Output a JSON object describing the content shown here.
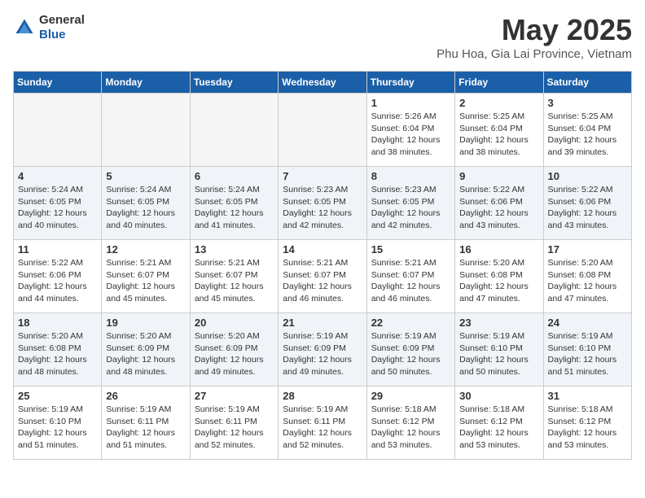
{
  "header": {
    "logo": {
      "text_general": "General",
      "text_blue": "Blue"
    },
    "title": "May 2025",
    "subtitle": "Phu Hoa, Gia Lai Province, Vietnam"
  },
  "weekdays": [
    "Sunday",
    "Monday",
    "Tuesday",
    "Wednesday",
    "Thursday",
    "Friday",
    "Saturday"
  ],
  "weeks": [
    {
      "shade": false,
      "days": [
        {
          "num": "",
          "info": ""
        },
        {
          "num": "",
          "info": ""
        },
        {
          "num": "",
          "info": ""
        },
        {
          "num": "",
          "info": ""
        },
        {
          "num": "1",
          "info": "Sunrise: 5:26 AM\nSunset: 6:04 PM\nDaylight: 12 hours\nand 38 minutes."
        },
        {
          "num": "2",
          "info": "Sunrise: 5:25 AM\nSunset: 6:04 PM\nDaylight: 12 hours\nand 38 minutes."
        },
        {
          "num": "3",
          "info": "Sunrise: 5:25 AM\nSunset: 6:04 PM\nDaylight: 12 hours\nand 39 minutes."
        }
      ]
    },
    {
      "shade": true,
      "days": [
        {
          "num": "4",
          "info": "Sunrise: 5:24 AM\nSunset: 6:05 PM\nDaylight: 12 hours\nand 40 minutes."
        },
        {
          "num": "5",
          "info": "Sunrise: 5:24 AM\nSunset: 6:05 PM\nDaylight: 12 hours\nand 40 minutes."
        },
        {
          "num": "6",
          "info": "Sunrise: 5:24 AM\nSunset: 6:05 PM\nDaylight: 12 hours\nand 41 minutes."
        },
        {
          "num": "7",
          "info": "Sunrise: 5:23 AM\nSunset: 6:05 PM\nDaylight: 12 hours\nand 42 minutes."
        },
        {
          "num": "8",
          "info": "Sunrise: 5:23 AM\nSunset: 6:05 PM\nDaylight: 12 hours\nand 42 minutes."
        },
        {
          "num": "9",
          "info": "Sunrise: 5:22 AM\nSunset: 6:06 PM\nDaylight: 12 hours\nand 43 minutes."
        },
        {
          "num": "10",
          "info": "Sunrise: 5:22 AM\nSunset: 6:06 PM\nDaylight: 12 hours\nand 43 minutes."
        }
      ]
    },
    {
      "shade": false,
      "days": [
        {
          "num": "11",
          "info": "Sunrise: 5:22 AM\nSunset: 6:06 PM\nDaylight: 12 hours\nand 44 minutes."
        },
        {
          "num": "12",
          "info": "Sunrise: 5:21 AM\nSunset: 6:07 PM\nDaylight: 12 hours\nand 45 minutes."
        },
        {
          "num": "13",
          "info": "Sunrise: 5:21 AM\nSunset: 6:07 PM\nDaylight: 12 hours\nand 45 minutes."
        },
        {
          "num": "14",
          "info": "Sunrise: 5:21 AM\nSunset: 6:07 PM\nDaylight: 12 hours\nand 46 minutes."
        },
        {
          "num": "15",
          "info": "Sunrise: 5:21 AM\nSunset: 6:07 PM\nDaylight: 12 hours\nand 46 minutes."
        },
        {
          "num": "16",
          "info": "Sunrise: 5:20 AM\nSunset: 6:08 PM\nDaylight: 12 hours\nand 47 minutes."
        },
        {
          "num": "17",
          "info": "Sunrise: 5:20 AM\nSunset: 6:08 PM\nDaylight: 12 hours\nand 47 minutes."
        }
      ]
    },
    {
      "shade": true,
      "days": [
        {
          "num": "18",
          "info": "Sunrise: 5:20 AM\nSunset: 6:08 PM\nDaylight: 12 hours\nand 48 minutes."
        },
        {
          "num": "19",
          "info": "Sunrise: 5:20 AM\nSunset: 6:09 PM\nDaylight: 12 hours\nand 48 minutes."
        },
        {
          "num": "20",
          "info": "Sunrise: 5:20 AM\nSunset: 6:09 PM\nDaylight: 12 hours\nand 49 minutes."
        },
        {
          "num": "21",
          "info": "Sunrise: 5:19 AM\nSunset: 6:09 PM\nDaylight: 12 hours\nand 49 minutes."
        },
        {
          "num": "22",
          "info": "Sunrise: 5:19 AM\nSunset: 6:09 PM\nDaylight: 12 hours\nand 50 minutes."
        },
        {
          "num": "23",
          "info": "Sunrise: 5:19 AM\nSunset: 6:10 PM\nDaylight: 12 hours\nand 50 minutes."
        },
        {
          "num": "24",
          "info": "Sunrise: 5:19 AM\nSunset: 6:10 PM\nDaylight: 12 hours\nand 51 minutes."
        }
      ]
    },
    {
      "shade": false,
      "days": [
        {
          "num": "25",
          "info": "Sunrise: 5:19 AM\nSunset: 6:10 PM\nDaylight: 12 hours\nand 51 minutes."
        },
        {
          "num": "26",
          "info": "Sunrise: 5:19 AM\nSunset: 6:11 PM\nDaylight: 12 hours\nand 51 minutes."
        },
        {
          "num": "27",
          "info": "Sunrise: 5:19 AM\nSunset: 6:11 PM\nDaylight: 12 hours\nand 52 minutes."
        },
        {
          "num": "28",
          "info": "Sunrise: 5:19 AM\nSunset: 6:11 PM\nDaylight: 12 hours\nand 52 minutes."
        },
        {
          "num": "29",
          "info": "Sunrise: 5:18 AM\nSunset: 6:12 PM\nDaylight: 12 hours\nand 53 minutes."
        },
        {
          "num": "30",
          "info": "Sunrise: 5:18 AM\nSunset: 6:12 PM\nDaylight: 12 hours\nand 53 minutes."
        },
        {
          "num": "31",
          "info": "Sunrise: 5:18 AM\nSunset: 6:12 PM\nDaylight: 12 hours\nand 53 minutes."
        }
      ]
    }
  ]
}
